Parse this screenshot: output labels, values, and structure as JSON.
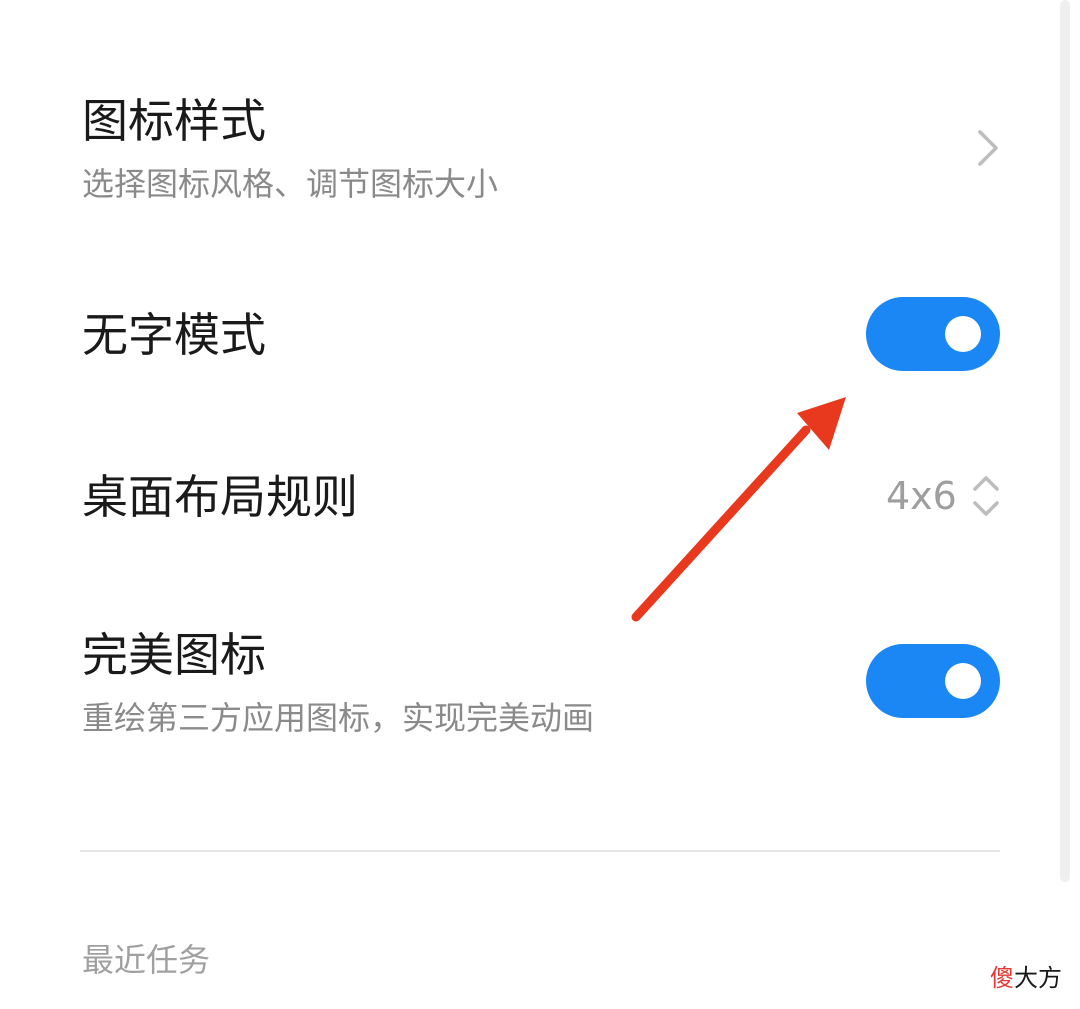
{
  "settings": {
    "icon_style": {
      "title": "图标样式",
      "subtitle": "选择图标风格、调节图标大小",
      "icon": "chevron-right-icon"
    },
    "no_text_mode": {
      "title": "无字模式",
      "enabled": true
    },
    "desktop_layout": {
      "title": "桌面布局规则",
      "value": "4x6",
      "icon": "up-down-chevron-icon"
    },
    "perfect_icons": {
      "title": "完美图标",
      "subtitle": "重绘第三方应用图标，实现完美动画",
      "enabled": true
    }
  },
  "section": {
    "recent_tasks": "最近任务"
  },
  "annotation": {
    "icon": "red-arrow-icon",
    "color": "#e8391f"
  },
  "watermark": {
    "first": "傻",
    "rest": "大方"
  },
  "colors": {
    "toggle_on": "#1a87f5",
    "title_text": "#1a1a1a",
    "subtitle_text": "#8a8a8a"
  }
}
